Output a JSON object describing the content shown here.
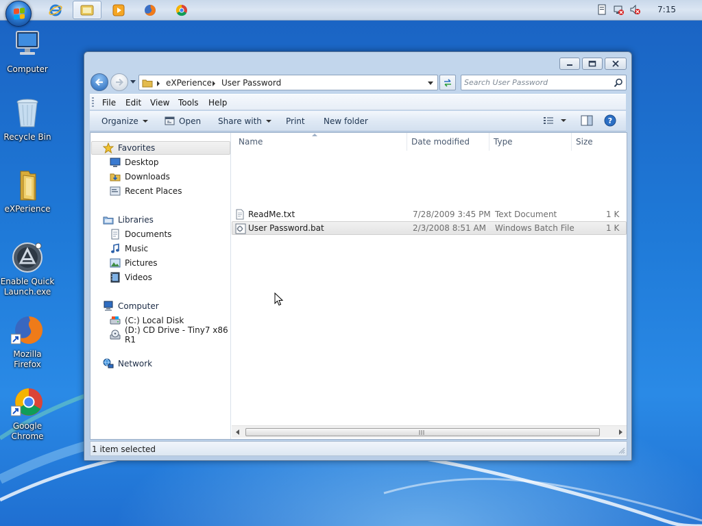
{
  "taskbar": {
    "clock": "7:15",
    "pinned": [
      "internet-explorer",
      "windows-explorer",
      "media-player",
      "firefox",
      "chrome"
    ]
  },
  "desktop_icons": [
    {
      "label": "Computer",
      "icon": "computer-icon"
    },
    {
      "label": "Recycle Bin",
      "icon": "recycle-bin-icon"
    },
    {
      "label": "eXPerience",
      "icon": "folder-icon"
    },
    {
      "label": "Enable Quick Launch.exe",
      "icon": "quick-launch-icon"
    },
    {
      "label": "Mozilla Firefox",
      "icon": "firefox-icon"
    },
    {
      "label": "Google Chrome",
      "icon": "chrome-icon"
    }
  ],
  "window": {
    "breadcrumb": [
      "eXPerience",
      "User Password"
    ],
    "search_placeholder": "Search User Password",
    "menu": [
      "File",
      "Edit",
      "View",
      "Tools",
      "Help"
    ],
    "commands": {
      "organize": "Organize",
      "open": "Open",
      "share_with": "Share with",
      "print": "Print",
      "new_folder": "New folder"
    },
    "nav": {
      "favorites": {
        "label": "Favorites",
        "items": [
          "Desktop",
          "Downloads",
          "Recent Places"
        ]
      },
      "libraries": {
        "label": "Libraries",
        "items": [
          "Documents",
          "Music",
          "Pictures",
          "Videos"
        ]
      },
      "computer": {
        "label": "Computer",
        "items": [
          "(C:) Local Disk",
          "(D:) CD Drive - Tiny7 x86 R1"
        ]
      },
      "network": {
        "label": "Network"
      }
    },
    "columns": [
      "Name",
      "Date modified",
      "Type",
      "Size"
    ],
    "files": [
      {
        "name": "ReadMe.txt",
        "date": "7/28/2009 3:45 PM",
        "type": "Text Document",
        "size": "1 K"
      },
      {
        "name": "User Password.bat",
        "date": "2/3/2008 8:51 AM",
        "type": "Windows Batch File",
        "size": "1 K"
      }
    ],
    "status": "1 item selected"
  },
  "colors": {
    "desktop_blue": "#1f7ad8",
    "chrome_frame": "#c2d6ec",
    "selection": "#e6e6e6"
  }
}
